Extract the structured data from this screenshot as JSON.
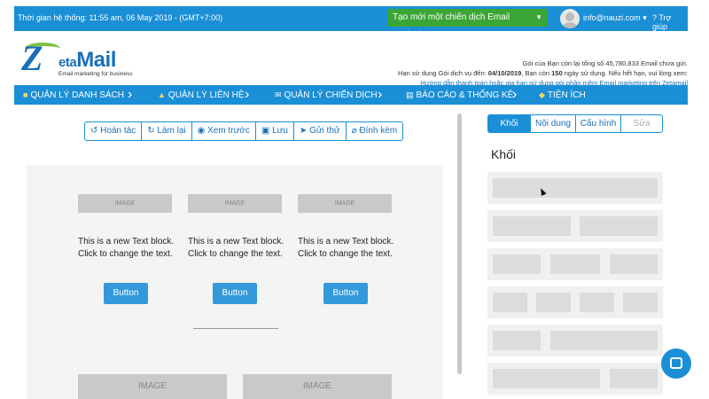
{
  "topbar": {
    "system_time": "Thời gian hệ thống: 11:55 am, 06 May 2019 - (GMT+7:00)",
    "create_campaign": "Tạo mới một chiến dịch Email Marketing",
    "user_email": "info@nauzi.com",
    "help": "Trợ giúp",
    "color": "#1a8fd6",
    "create_color": "#3aa635"
  },
  "logo": {
    "brand_z": "Z",
    "brand_eta": "eta",
    "brand_mail": "Mail",
    "tagline": "Email marketing for business"
  },
  "account_info": {
    "line1": "Gói của Bạn còn lại tổng số 45,780,833 Email chưa gửi.",
    "line2_prefix": "Hạn sử dụng Gói dịch vụ đến: ",
    "expiry": "04/10/2019",
    "line2_mid": ", Bạn còn ",
    "days": "150",
    "line2_suffix": " ngày sử dụng. Nếu hết hạn, vui lòng xem:",
    "guide_link": "Hướng dẫn thanh toán hoặc gia hạn sử dụng gói phần mềm Email marketing trên Zetamail"
  },
  "nav": {
    "items": [
      {
        "label": "QUẢN LÝ DANH SÁCH",
        "icon": "folder-icon"
      },
      {
        "label": "QUẢN LÝ LIÊN HỆ",
        "icon": "contacts-icon"
      },
      {
        "label": "QUẢN LÝ CHIẾN DỊCH",
        "icon": "envelope-icon"
      },
      {
        "label": "BÁO CÁO & THỐNG KÊ",
        "icon": "report-icon"
      },
      {
        "label": "TIỆN ÍCH",
        "icon": "gift-icon"
      }
    ]
  },
  "toolbar": {
    "undo": "Hoàn tác",
    "redo": "Làm lại",
    "preview": "Xem trước",
    "save": "Lưu",
    "send_test": "Gửi thử",
    "attach": "Đính kèm"
  },
  "canvas": {
    "image_label_small": "IMAGE",
    "image_label_large": "IMAGE",
    "text_line1": "This is a new Text block.",
    "text_line2": "Click to change the text.",
    "button_label": "Button"
  },
  "panel": {
    "tabs": [
      "Khối",
      "Nội dung",
      "Cấu hình",
      "Sửa"
    ],
    "active_tab": "Khối",
    "title": "Khối"
  }
}
